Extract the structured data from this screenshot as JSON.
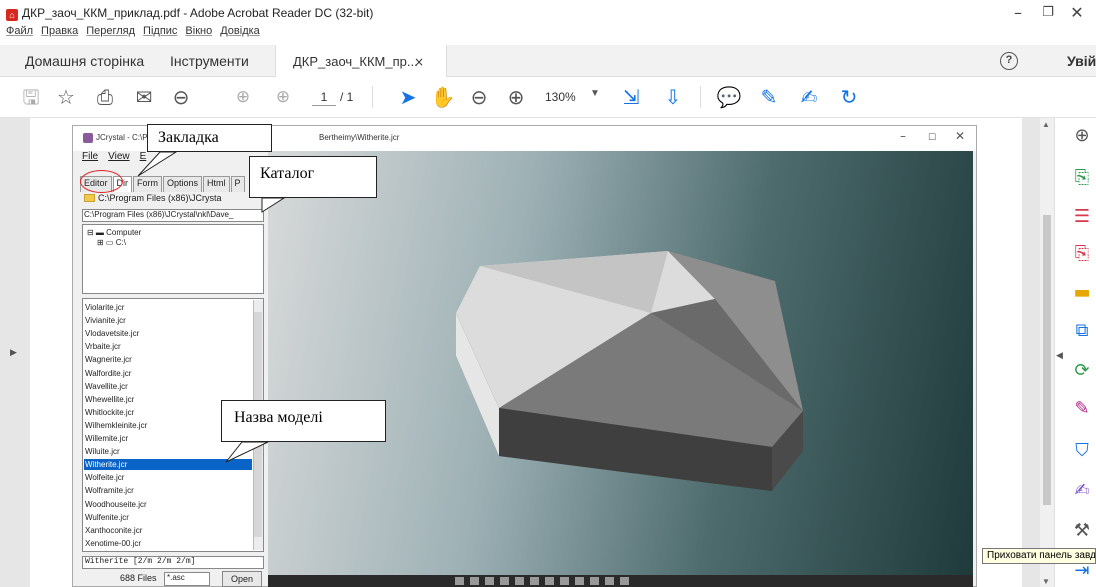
{
  "window": {
    "title": "ДКР_заоч_ККМ_приклад.pdf - Adobe Acrobat Reader DC (32-bit)"
  },
  "menu": [
    "Файл",
    "Правка",
    "Перегляд",
    "Підпис",
    "Вікно",
    "Довідка"
  ],
  "tabs": {
    "home": "Домашня сторінка",
    "tools": "Інструменти",
    "document": "ДКР_заоч_ККМ_пр...",
    "signin": "Увійти"
  },
  "toolbar": {
    "page_current": "1",
    "page_total": "/ 1",
    "zoom": "130%"
  },
  "tooltip": "Приховати панель завдань",
  "jcrystal": {
    "title_left": "JCrystal - C:\\P",
    "title_right": "Bertheimy\\Witherite.jcr",
    "menu": [
      "File",
      "View",
      "E"
    ],
    "tabs": [
      "Editor",
      "Dir",
      "Form",
      "Options",
      "Html",
      "P"
    ],
    "folder": "C:\\Program Files (x86)\\JCrysta",
    "path": "C:\\Program Files (x86)\\JCrystal\\nkl\\Dave_",
    "tree": [
      "Computer",
      "C:\\"
    ],
    "files": [
      "Violarite.jcr",
      "Vivianite.jcr",
      "Vlodavetsite.jcr",
      "Vrbaite.jcr",
      "Wagnerite.jcr",
      "Walfordite.jcr",
      "Wavellite.jcr",
      "Whewellite.jcr",
      "Whitlockite.jcr",
      "Wilhemkleinite.jcr",
      "Willemite.jcr",
      "Wiluite.jcr",
      "Witherite.jcr",
      "Wolfeite.jcr",
      "Wolframite.jcr",
      "Woodhouseite.jcr",
      "Wulfenite.jcr",
      "Xanthoconite.jcr",
      "Xenotime-00.jcr"
    ],
    "selected_index": 12,
    "status": "Witherite [2/m 2/m 2/m]",
    "file_count": "688 Files",
    "filter": "*.asc",
    "open_button": "Open"
  },
  "callouts": {
    "bookmark": "Закладка",
    "catalog": "Каталог",
    "model_name": "Назва моделі"
  }
}
